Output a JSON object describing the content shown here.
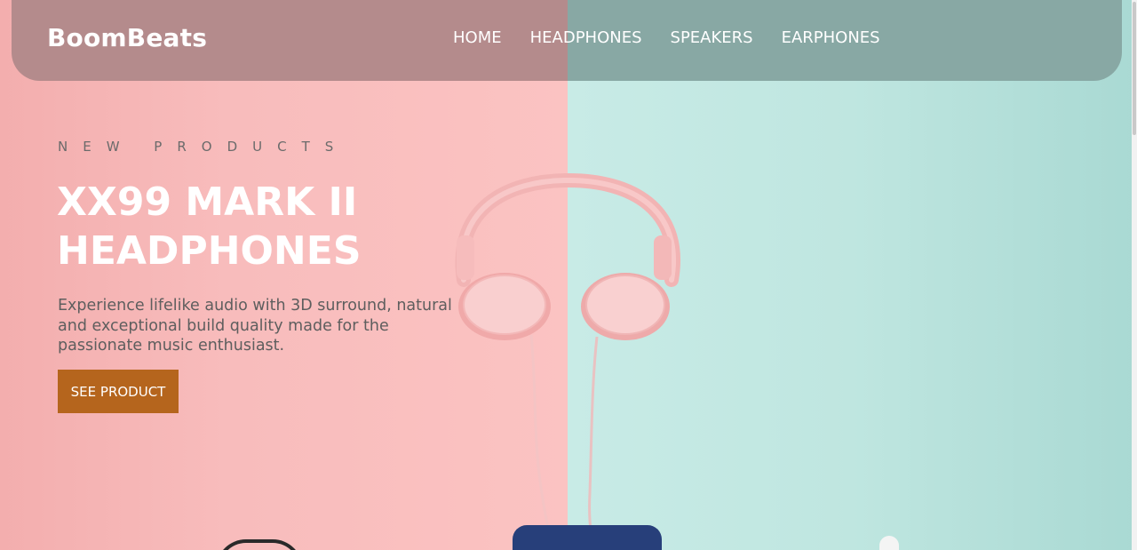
{
  "brand": {
    "name": "BoomBeats"
  },
  "nav": {
    "items": [
      {
        "label": "HOME"
      },
      {
        "label": "HEADPHONES"
      },
      {
        "label": "SPEAKERS"
      },
      {
        "label": "EARPHONES"
      }
    ]
  },
  "hero": {
    "eyebrow": "NEW PRODUCTS",
    "title": "XX99 MARK II HEADPHONES",
    "description": "Experience lifelike audio with 3D surround, natural and exceptional build quality made for the passionate music enthusiast.",
    "cta_label": "SEE PRODUCT"
  },
  "colors": {
    "bg_left": "#f8bcbc",
    "bg_right": "#c0e7e1",
    "nav_left": "#b48b8c",
    "nav_right": "#88a8a4",
    "cta": "#b5651d",
    "heading": "#ffffff",
    "body_text": "#5e5e5e"
  },
  "icons": {
    "hero_image": "pink-headphones-illustration",
    "speaker": "blue-speaker-illustration",
    "earbud": "earbud-illustration"
  }
}
